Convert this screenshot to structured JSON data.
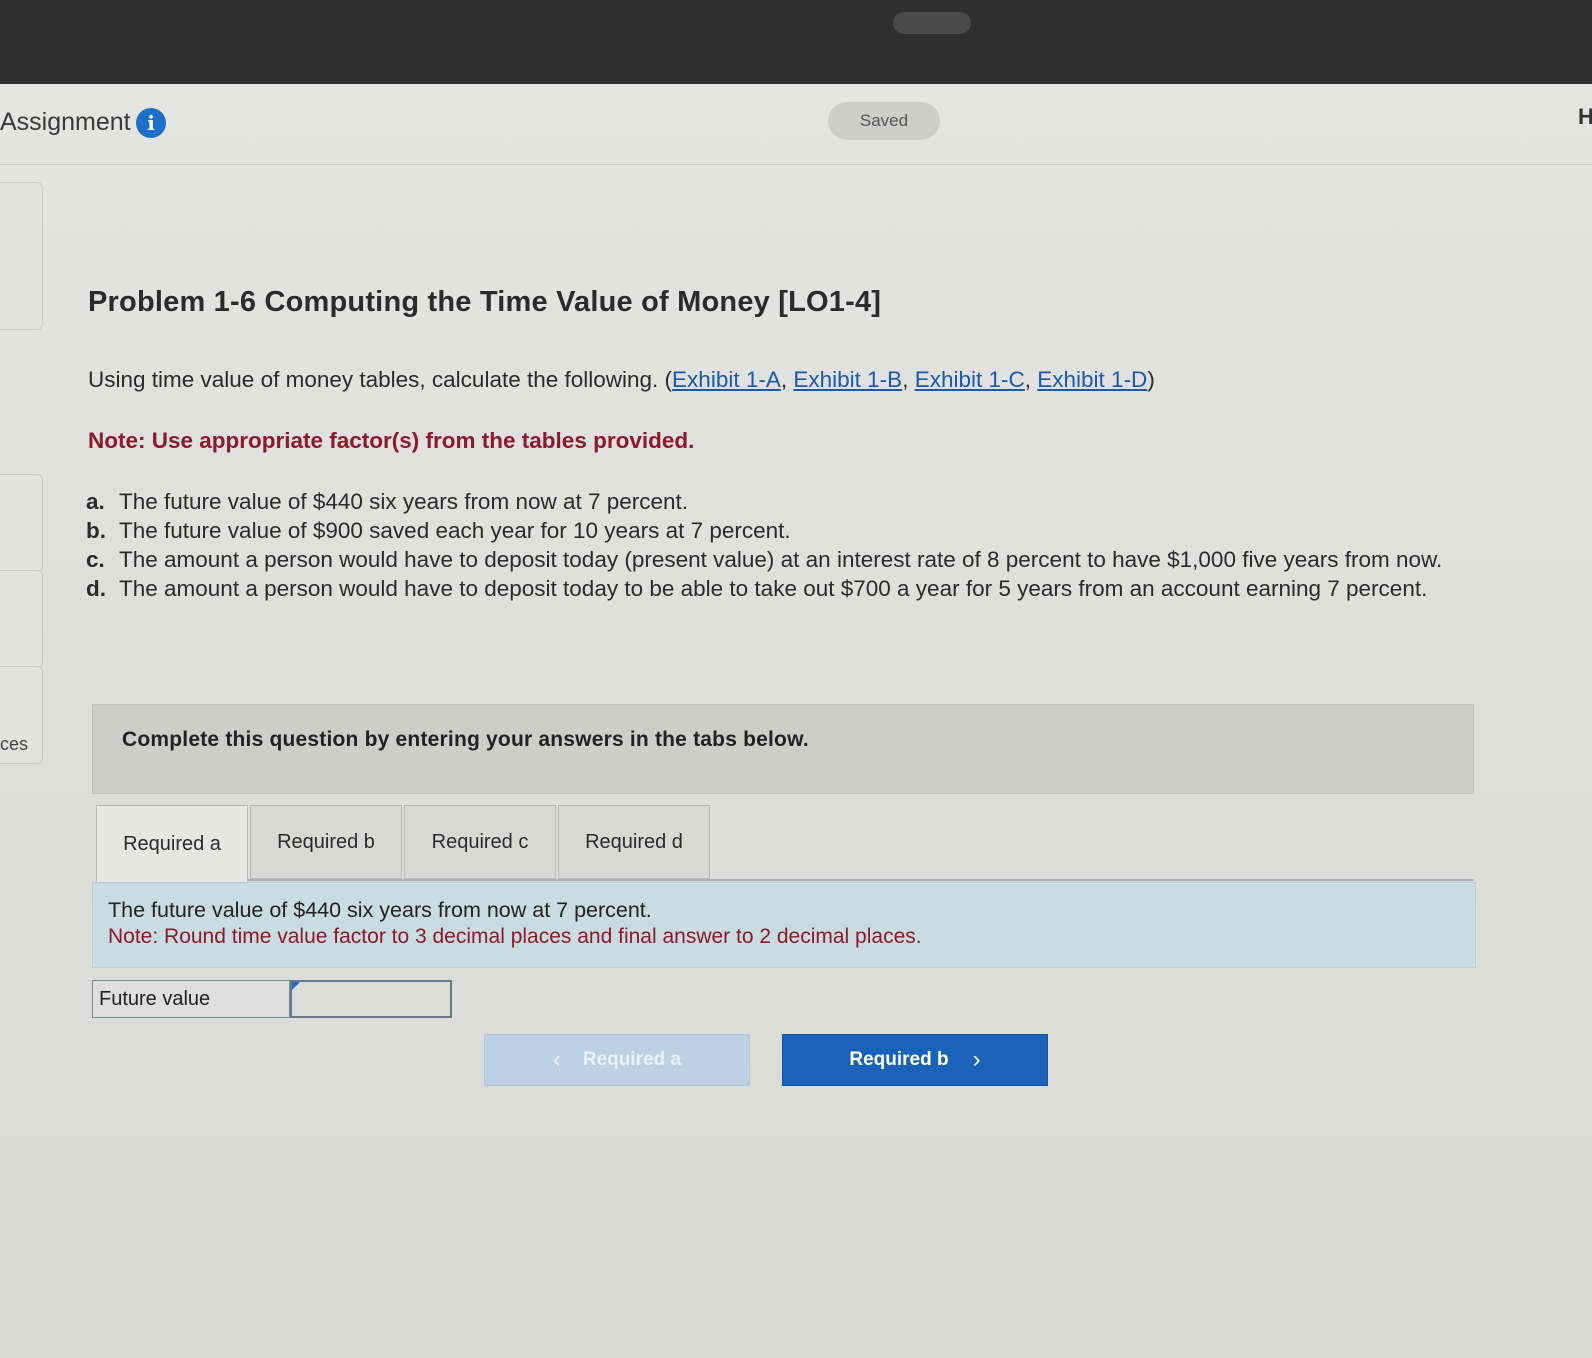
{
  "header": {
    "assignment_title": "Assignment",
    "info_icon": "info-icon",
    "saved_label": "Saved",
    "right_edge_char": "H"
  },
  "sidebar": {
    "partial_label": "ces"
  },
  "problem": {
    "title": "Problem 1-6 Computing the Time Value of Money [LO1-4]",
    "intro_text": "Using time value of money tables, calculate the following. (",
    "exhibits": [
      "Exhibit 1-A",
      "Exhibit 1-B",
      "Exhibit 1-C",
      "Exhibit 1-D"
    ],
    "separator": ", ",
    "intro_close": ")",
    "note": "Note: Use appropriate factor(s) from the tables provided.",
    "requirements": [
      {
        "letter": "a.",
        "text": "The future value of $440 six years from now at 7 percent."
      },
      {
        "letter": "b.",
        "text": "The future value of $900 saved each year for 10 years at 7 percent."
      },
      {
        "letter": "c.",
        "text": "The amount a person would have to deposit today (present value) at an interest rate of 8 percent to have $1,000 five years from now."
      },
      {
        "letter": "d.",
        "text": "The amount a person would have to deposit today to be able to take out $700 a year for 5 years from an account earning 7 percent."
      }
    ]
  },
  "instructions": "Complete this question by entering your answers in the tabs below.",
  "tabs": [
    {
      "label": "Required a",
      "active": true
    },
    {
      "label": "Required b",
      "active": false
    },
    {
      "label": "Required c",
      "active": false
    },
    {
      "label": "Required d",
      "active": false
    }
  ],
  "panel": {
    "question": "The future value of $440 six years from now at 7 percent.",
    "note": "Note: Round time value factor to 3 decimal places and final answer to 2 decimal places."
  },
  "answer": {
    "label": "Future value",
    "value": ""
  },
  "navigation": {
    "prev_label": "Required a",
    "next_label": "Required b",
    "prev_icon": "chevron-left-icon",
    "next_icon": "chevron-right-icon"
  }
}
